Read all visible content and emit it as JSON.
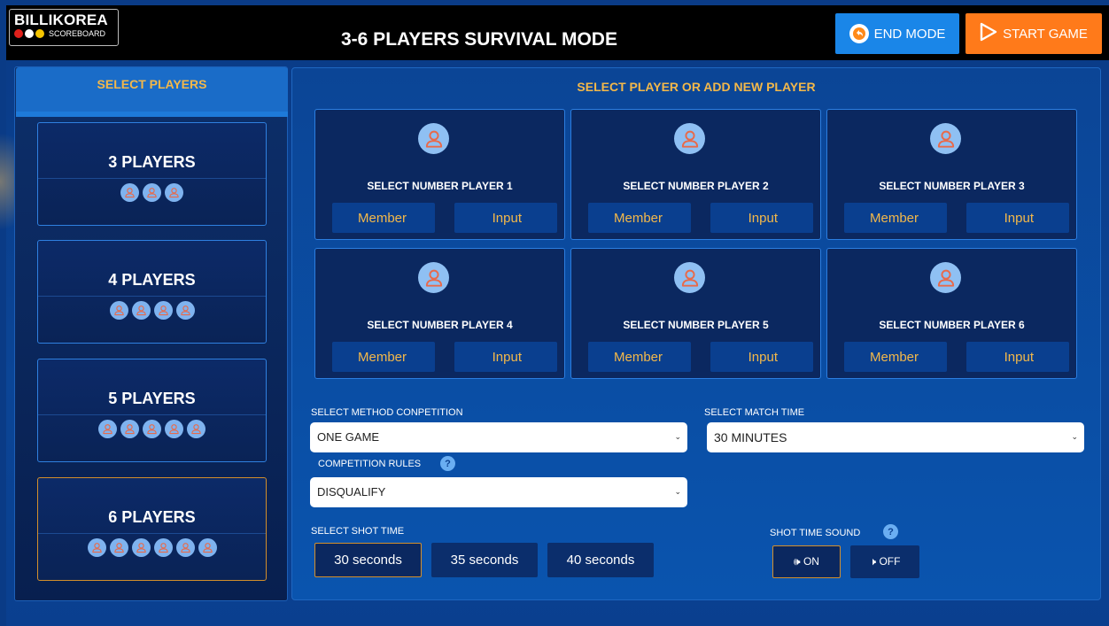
{
  "header": {
    "logo_name": "BILLIKOREA",
    "logo_sub": "SCOREBOARD",
    "title": "3-6 PLAYERS SURVIVAL MODE",
    "end_mode_label": "END MODE",
    "start_game_label": "START GAME"
  },
  "sidebar": {
    "header": "SELECT PLAYERS",
    "options": [
      {
        "label": "3 PLAYERS",
        "count": 3,
        "selected": false
      },
      {
        "label": "4 PLAYERS",
        "count": 4,
        "selected": false
      },
      {
        "label": "5 PLAYERS",
        "count": 5,
        "selected": false
      },
      {
        "label": "6 PLAYERS",
        "count": 6,
        "selected": true
      }
    ]
  },
  "main": {
    "title": "SELECT PLAYER OR ADD NEW PLAYER",
    "slots": [
      {
        "label": "SELECT NUMBER PLAYER 1",
        "member": "Member",
        "input": "Input"
      },
      {
        "label": "SELECT NUMBER PLAYER 2",
        "member": "Member",
        "input": "Input"
      },
      {
        "label": "SELECT NUMBER PLAYER 3",
        "member": "Member",
        "input": "Input"
      },
      {
        "label": "SELECT NUMBER PLAYER 4",
        "member": "Member",
        "input": "Input"
      },
      {
        "label": "SELECT NUMBER PLAYER 5",
        "member": "Member",
        "input": "Input"
      },
      {
        "label": "SELECT NUMBER PLAYER 6",
        "member": "Member",
        "input": "Input"
      }
    ],
    "method": {
      "label": "SELECT METHOD CONPETITION",
      "value": "ONE GAME"
    },
    "match_time": {
      "label": "SELECT MATCH TIME",
      "value": "30 MINUTES"
    },
    "rules": {
      "label": "COMPETITION RULES",
      "value": "DISQUALIFY"
    },
    "shot_time": {
      "label": "SELECT SHOT TIME",
      "options": [
        "30 seconds",
        "35 seconds",
        "40 seconds"
      ],
      "selected": "30 seconds"
    },
    "sound": {
      "label": "SHOT TIME SOUND",
      "on": "ON",
      "off": "OFF",
      "selected": "ON"
    }
  },
  "colors": {
    "accent_orange": "#ff7a1a",
    "accent_blue": "#1a86e8",
    "gold_text": "#f3b84a",
    "logo_dots": [
      "#e0201b",
      "#ffffff",
      "#f5c400"
    ]
  }
}
